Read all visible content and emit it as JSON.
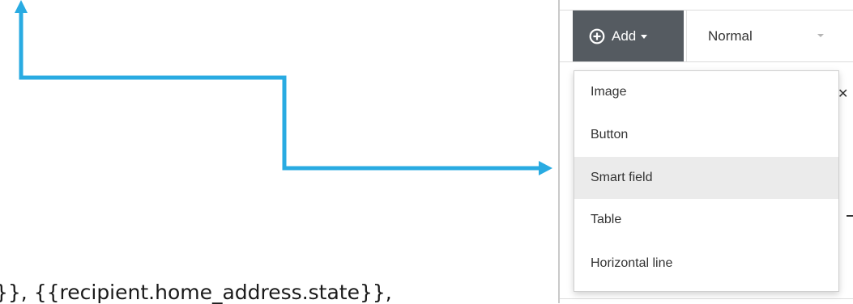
{
  "background": {
    "template_text": "}}, {{recipient.home_address.state}},"
  },
  "annotation": {
    "arrow_color": "#29abe2",
    "icon": "arrow-icon"
  },
  "toolbar": {
    "add_button_label": "Add",
    "add_button_icon": "plus-circle-icon",
    "add_button_color": "#555b61",
    "style_select_value": "Normal"
  },
  "add_menu": {
    "items": [
      {
        "label": "Image"
      },
      {
        "label": "Button"
      },
      {
        "label": "Smart field",
        "highlighted": true
      },
      {
        "label": "Table"
      },
      {
        "label": "Horizontal line"
      }
    ]
  }
}
